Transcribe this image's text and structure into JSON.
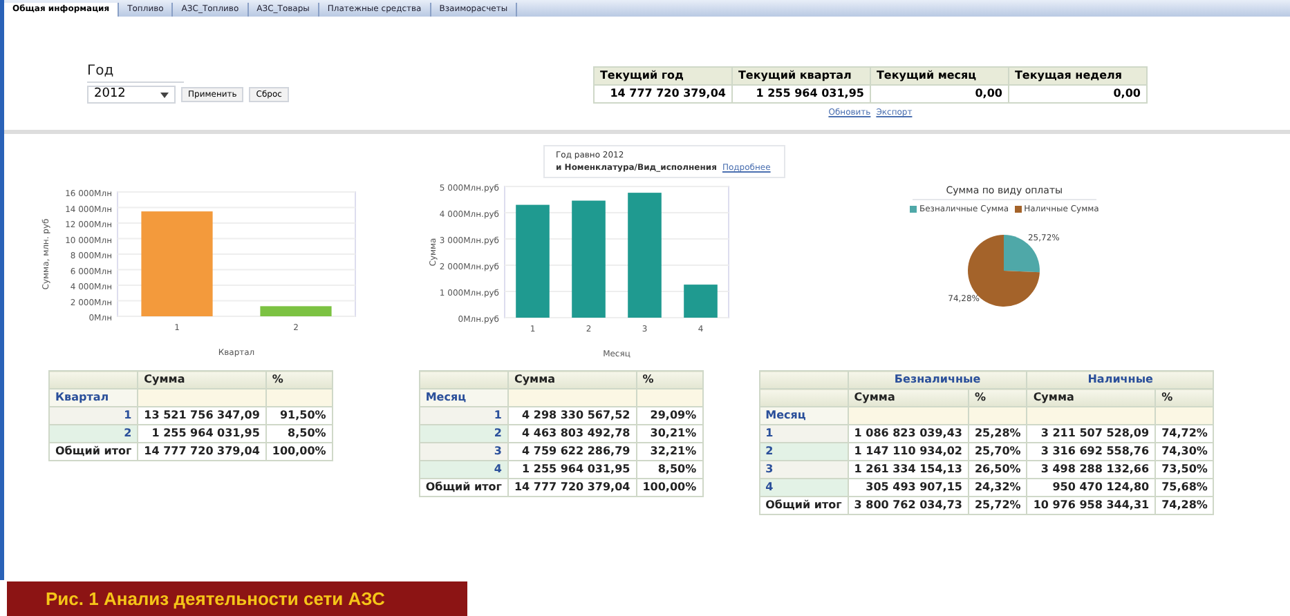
{
  "tabs": [
    {
      "label": "Общая информация",
      "selected": true
    },
    {
      "label": "Топливо",
      "selected": false
    },
    {
      "label": "АЗС_Топливо",
      "selected": false
    },
    {
      "label": "АЗС_Товары",
      "selected": false
    },
    {
      "label": "Платежные средства",
      "selected": false
    },
    {
      "label": "Взаиморасчеты",
      "selected": false
    }
  ],
  "filter": {
    "label": "Год",
    "value": "2012",
    "buttons": [
      "Применить",
      "Сброс"
    ]
  },
  "summary": {
    "columns": [
      "Текущий год",
      "Текущий квартал",
      "Текущий месяц",
      "Текущая неделя"
    ],
    "values": [
      "14 777 720 379,04",
      "1 255 964 031,95",
      "0,00",
      "0,00"
    ],
    "links": [
      "Обновить",
      "Экспорт"
    ]
  },
  "quarter_chart": {
    "chart_data": {
      "type": "bar",
      "grid": true,
      "xlabel": "Квартал",
      "ylabel": "Сумма, млн. руб",
      "categories": [
        "1",
        "2"
      ],
      "values": [
        13500,
        1300
      ],
      "ylim": [
        0,
        16000
      ],
      "yticks": [
        {
          "value": 0,
          "label": "0Млн"
        },
        {
          "value": 2000,
          "label": "2 000Млн"
        },
        {
          "value": 4000,
          "label": "4 000Млн"
        },
        {
          "value": 6000,
          "label": "6 000Млн"
        },
        {
          "value": 8000,
          "label": "8 000Млн"
        },
        {
          "value": 10000,
          "label": "10 000Млн"
        },
        {
          "value": 12000,
          "label": "12 000Млн"
        },
        {
          "value": 14000,
          "label": "14 000Млн"
        },
        {
          "value": 16000,
          "label": "16 000Млн"
        }
      ]
    }
  },
  "prompt": {
    "lines": [
      "Год равно 2012",
      "и Номенклатура/Вид_исполнения"
    ],
    "link": "Подробнее"
  },
  "month_chart": {
    "chart_data": {
      "type": "bar",
      "grid": true,
      "xlabel": "Месяц",
      "ylabel": "Сумма",
      "categories": [
        "1",
        "2",
        "3",
        "4"
      ],
      "values": [
        4300,
        4460,
        4760,
        1260
      ],
      "ylim": [
        0,
        5000
      ],
      "yticks": [
        {
          "value": 0,
          "label": "0Млн.руб"
        },
        {
          "value": 1000,
          "label": "1 000Млн.руб"
        },
        {
          "value": 2000,
          "label": "2 000Млн.руб"
        },
        {
          "value": 3000,
          "label": "3 000Млн.руб"
        },
        {
          "value": 4000,
          "label": "4 000Млн.руб"
        },
        {
          "value": 5000,
          "label": "5 000Млн.руб"
        }
      ]
    }
  },
  "pay_chart": {
    "chart_data": {
      "type": "pie",
      "title": "Сумма по виду оплаты",
      "legend": "top",
      "categories": [
        "Безналичные Сумма",
        "Наличные Сумма"
      ],
      "values": [
        25.72,
        74.28
      ],
      "value_labels": [
        "25,72%",
        "74,28%"
      ]
    }
  },
  "quarter_table": {
    "columns": [
      "Сумма",
      "%"
    ],
    "dimension": "Квартал",
    "rows": [
      {
        "label": "1",
        "cells": [
          "13 521 756 347,09",
          "91,50%"
        ]
      },
      {
        "label": "2",
        "cells": [
          "1 255 964 031,95",
          "8,50%"
        ]
      }
    ],
    "total": {
      "label": "Общий итог",
      "cells": [
        "14 777 720 379,04",
        "100,00%"
      ]
    }
  },
  "month_table": {
    "columns": [
      "Сумма",
      "%"
    ],
    "dimension": "Месяц",
    "rows": [
      {
        "label": "1",
        "cells": [
          "4 298 330 567,52",
          "29,09%"
        ]
      },
      {
        "label": "2",
        "cells": [
          "4 463 803 492,78",
          "30,21%"
        ]
      },
      {
        "label": "3",
        "cells": [
          "4 759 622 286,79",
          "32,21%"
        ]
      },
      {
        "label": "4",
        "cells": [
          "1 255 964 031,95",
          "8,50%"
        ]
      }
    ],
    "total": {
      "label": "Общий итог",
      "cells": [
        "14 777 720 379,04",
        "100,00%"
      ]
    }
  },
  "pay_table": {
    "groups": [
      "Безналичные",
      "Наличные"
    ],
    "columns": [
      "Сумма",
      "%",
      "Сумма",
      "%"
    ],
    "dimension": "Месяц",
    "rows": [
      {
        "label": "1",
        "cells": [
          "1 086 823 039,43",
          "25,28%",
          "3 211 507 528,09",
          "74,72%"
        ]
      },
      {
        "label": "2",
        "cells": [
          "1 147 110 934,02",
          "25,70%",
          "3 316 692 558,76",
          "74,30%"
        ]
      },
      {
        "label": "3",
        "cells": [
          "1 261 334 154,13",
          "26,50%",
          "3 498 288 132,66",
          "73,50%"
        ]
      },
      {
        "label": "4",
        "cells": [
          "305 493 907,15",
          "24,32%",
          "950 470 124,80",
          "75,68%"
        ]
      }
    ],
    "total": {
      "label": "Общий итог",
      "cells": [
        "3 800 762 034,73",
        "25,72%",
        "10 976 958 344,31",
        "74,28%"
      ]
    }
  },
  "caption": "Рис. 1 Анализ деятельности сети АЗС"
}
